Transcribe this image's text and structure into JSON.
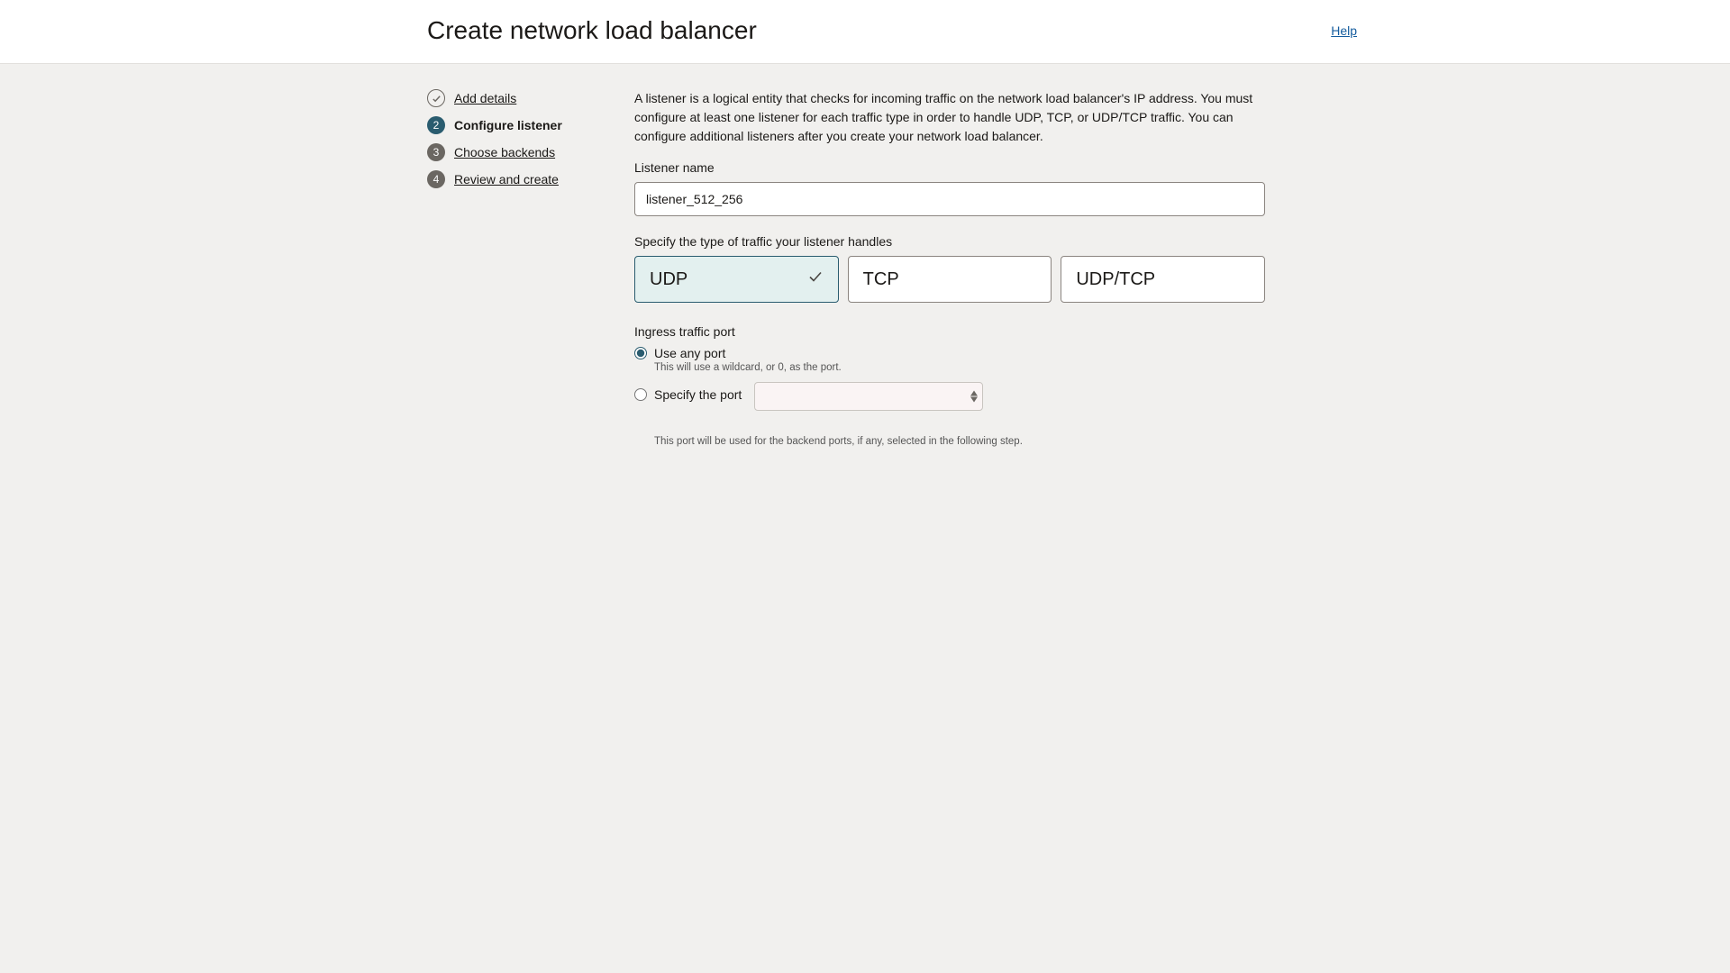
{
  "header": {
    "title": "Create network load balancer",
    "help": "Help"
  },
  "steps": [
    {
      "label": "Add details",
      "state": "completed"
    },
    {
      "label": "Configure listener",
      "state": "active"
    },
    {
      "label": "Choose backends",
      "state": "pending",
      "num": "3"
    },
    {
      "label": "Review and create",
      "state": "pending",
      "num": "4"
    }
  ],
  "intro": "A listener is a logical entity that checks for incoming traffic on the network load balancer's IP address. You must configure at least one listener for each traffic type in order to handle UDP, TCP, or UDP/TCP traffic. You can configure additional listeners after you create your network load balancer.",
  "listener_name": {
    "label": "Listener name",
    "value": "listener_512_256"
  },
  "traffic_type": {
    "label": "Specify the type of traffic your listener handles",
    "options": {
      "udp": "UDP",
      "tcp": "TCP",
      "udptcp": "UDP/TCP"
    },
    "selected": "udp"
  },
  "ingress": {
    "label": "Ingress traffic port",
    "use_any": {
      "label": "Use any port",
      "help": "This will use a wildcard, or 0, as the port."
    },
    "specify": {
      "label": "Specify the port",
      "value": ""
    },
    "footer": "This port will be used for the backend ports, if any, selected in the following step."
  }
}
